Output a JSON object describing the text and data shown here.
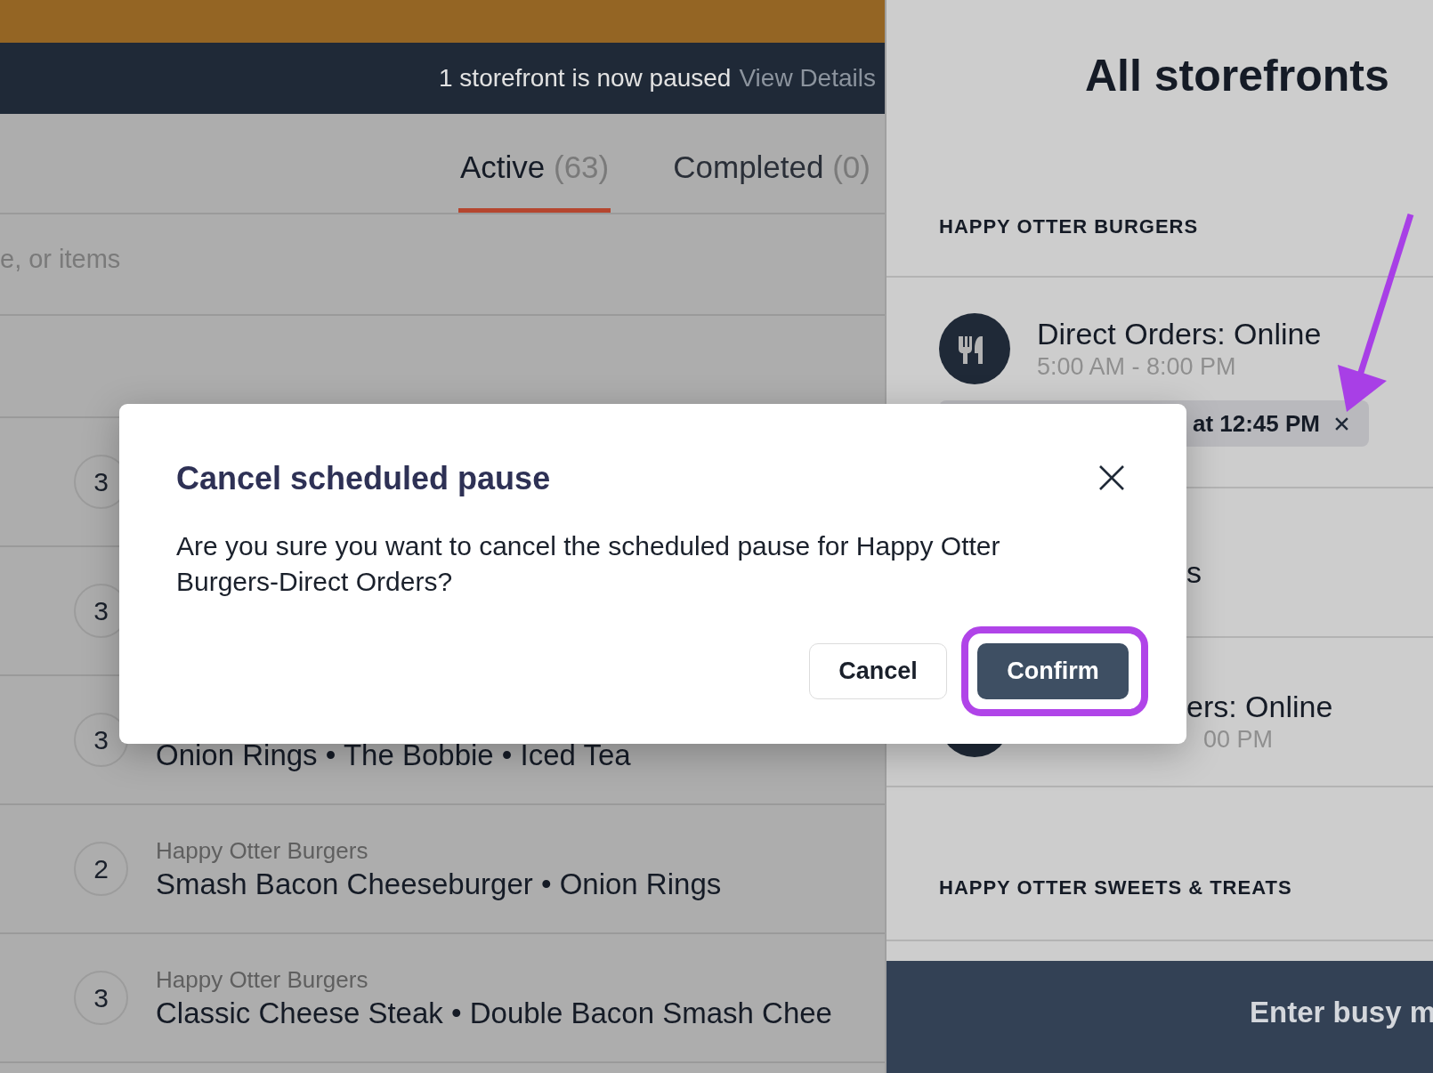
{
  "top_banner": {
    "message": "1 storefront is now paused",
    "link": "View Details"
  },
  "tabs": [
    {
      "label": "Active",
      "count": "(63)",
      "selected": true
    },
    {
      "label": "Completed",
      "count": "(0)",
      "selected": false
    }
  ],
  "search": {
    "placeholder": "e, or items"
  },
  "orders": [
    {
      "count": "3"
    },
    {
      "count": "3"
    },
    {
      "count": "3",
      "items": "Onion Rings • The Bobbie • Iced Tea"
    },
    {
      "count": "2",
      "store": "Happy Otter Burgers",
      "items": "Smash Bacon Cheeseburger • Onion Rings"
    },
    {
      "count": "3",
      "store": "Happy Otter Burgers",
      "items": "Classic Cheese Steak • Double Bacon Smash Chee"
    }
  ],
  "storefronts_panel": {
    "title": "All storefronts",
    "sections": [
      {
        "name": "HAPPY OTTER BURGERS",
        "storefronts": [
          {
            "kind": "full",
            "name": "Direct Orders: Online",
            "hours": "5:00 AM - 8:00 PM",
            "scheduled_pause": "at 12:45 PM"
          },
          {
            "kind": "covered",
            "name": "s"
          },
          {
            "kind": "covered",
            "name": "ers: Online",
            "hours": "00 PM"
          }
        ]
      },
      {
        "name": "HAPPY OTTER SWEETS & TREATS"
      }
    ],
    "footer_button": "Enter busy m"
  },
  "dialog": {
    "title": "Cancel scheduled pause",
    "message": "Are you sure you want to cancel the scheduled pause for Happy Otter Burgers-Direct Orders?",
    "buttons": [
      {
        "label": "Cancel",
        "kind": "secondary",
        "highlighted": false
      },
      {
        "label": "Confirm",
        "kind": "primary",
        "highlighted": true
      }
    ]
  }
}
